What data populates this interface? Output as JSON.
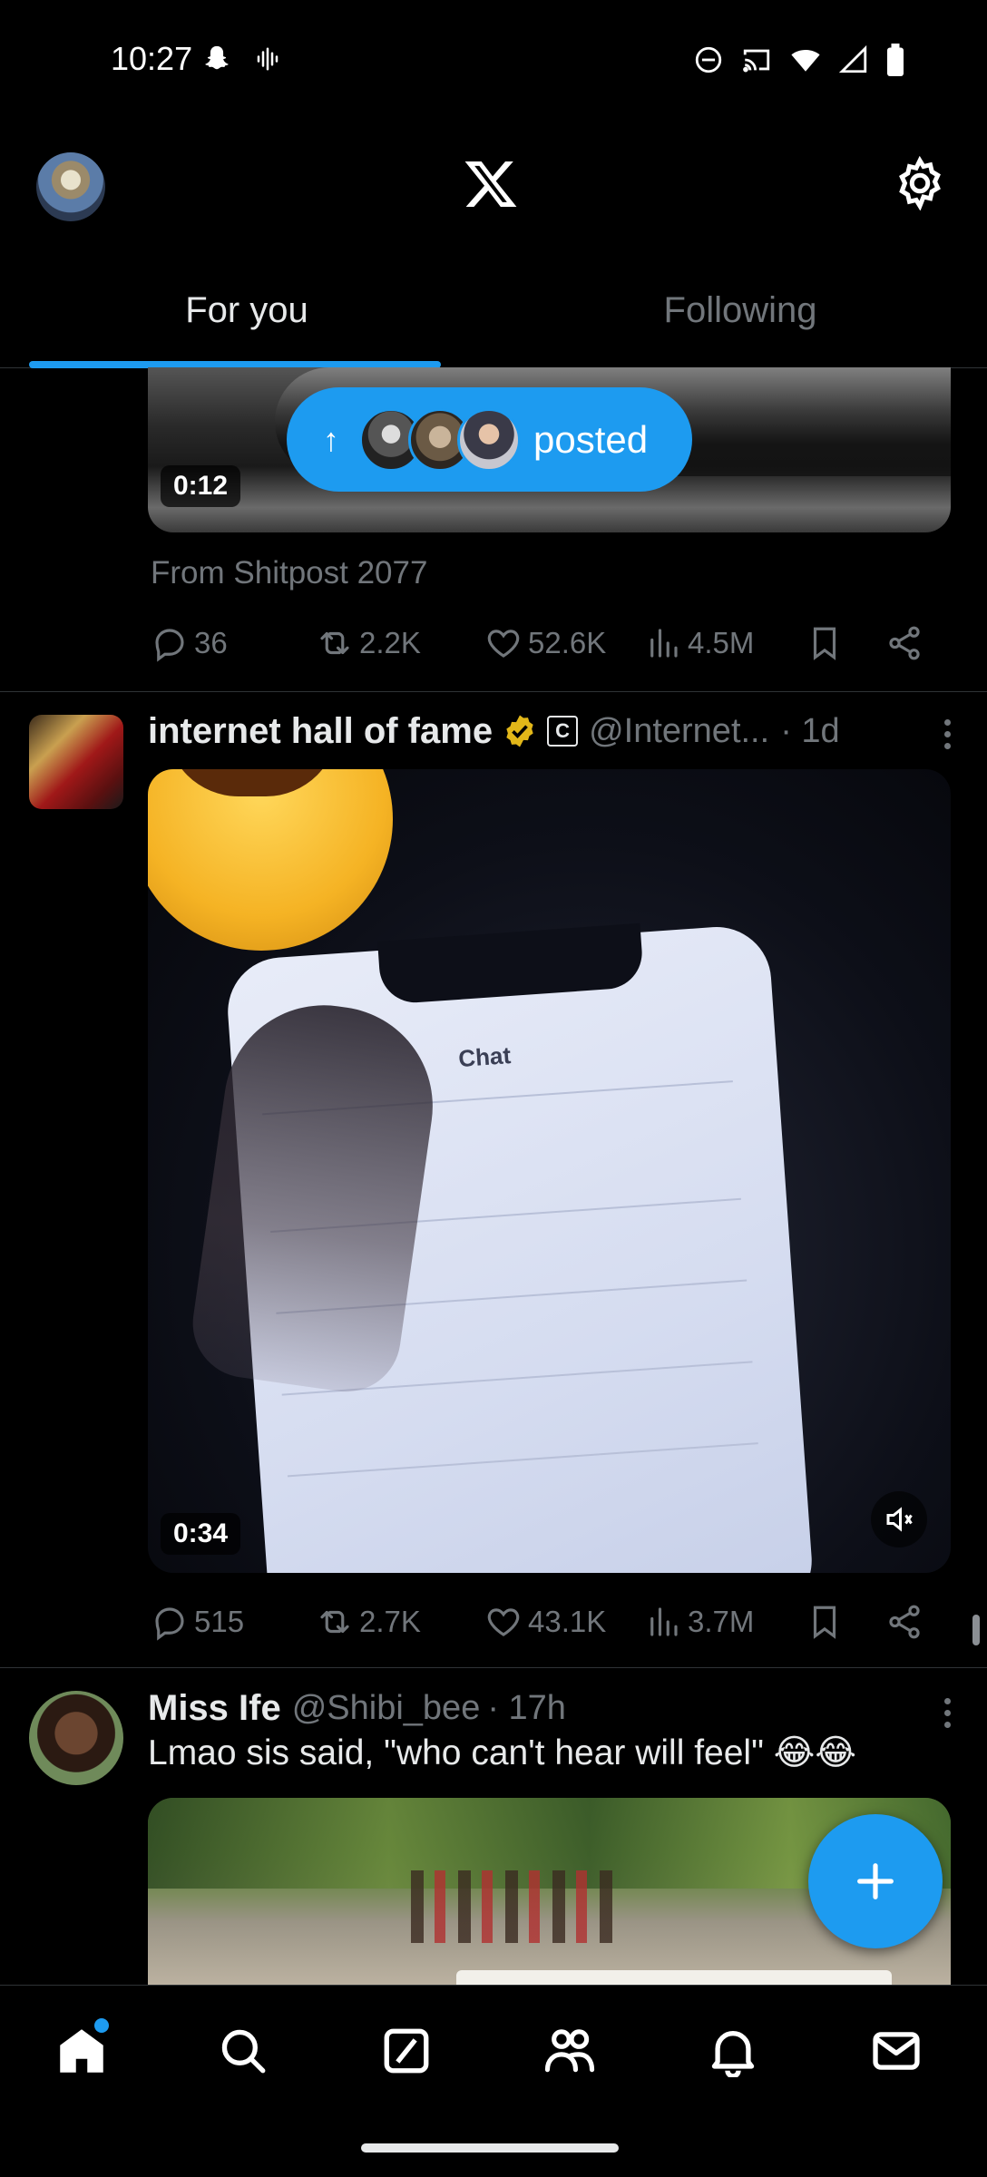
{
  "status_bar": {
    "time": "10:27",
    "left_icons": [
      "snapchat-icon",
      "audio-wave-icon"
    ],
    "right_icons": [
      "do-not-disturb-icon",
      "cast-icon",
      "wifi-icon",
      "signal-icon",
      "battery-icon"
    ]
  },
  "header": {
    "logo": "x-logo",
    "settings_icon": "gear-icon"
  },
  "tabs": [
    {
      "label": "For you",
      "active": true
    },
    {
      "label": "Following",
      "active": false
    }
  ],
  "accent_color": "#1d9bf0",
  "posted_pill": {
    "label": "posted",
    "arrow": "↑"
  },
  "tweet1": {
    "video_duration": "0:12",
    "from_text": "From Shitpost 2077",
    "replies": "36",
    "reposts": "2.2K",
    "likes": "52.6K",
    "views": "4.5M"
  },
  "tweet2": {
    "name": "internet hall of fame",
    "affiliate_badge": "C",
    "handle": "@Internet...",
    "time": "· 1d",
    "video_duration": "0:34",
    "video_screen_title": "Chat",
    "replies": "515",
    "reposts": "2.7K",
    "likes": "43.1K",
    "views": "3.7M"
  },
  "tweet3": {
    "name": "Miss Ife",
    "handle": "@Shibi_bee",
    "time": "· 17h",
    "text": "Lmao sis said, \"who can't hear will feel\" 😂😂"
  },
  "fab": {
    "icon": "plus-icon"
  },
  "bottom_nav": [
    {
      "name": "home",
      "icon": "home-icon",
      "has_dot": true
    },
    {
      "name": "search",
      "icon": "search-icon"
    },
    {
      "name": "grok",
      "icon": "grok-icon"
    },
    {
      "name": "communities",
      "icon": "communities-icon"
    },
    {
      "name": "notifications",
      "icon": "bell-icon"
    },
    {
      "name": "messages",
      "icon": "mail-icon"
    }
  ]
}
